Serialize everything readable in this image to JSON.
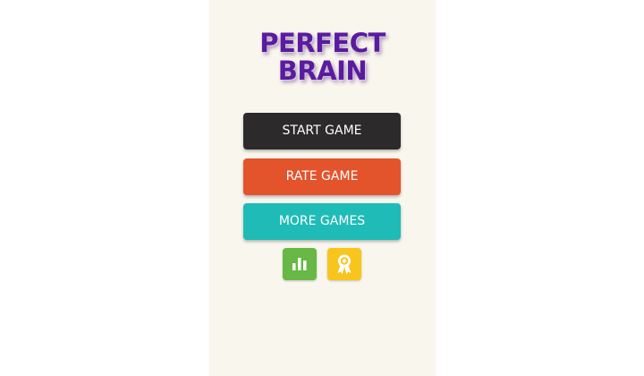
{
  "title": {
    "line1": "PERFECT",
    "line2": "BRAIN"
  },
  "menu": {
    "start_label": "START GAME",
    "rate_label": "RATE GAME",
    "more_label": "MORE GAMES"
  },
  "icons": {
    "leaderboard": "bar-chart-icon",
    "achievements": "award-ribbon-icon"
  },
  "colors": {
    "title": "#5a1b9e",
    "start_button": "#2d2a2b",
    "rate_button": "#e3532c",
    "more_button": "#1fbcb7",
    "leaderboard_button": "#68b845",
    "achievements_button": "#f8c51d",
    "background": "#f9f6ee"
  }
}
